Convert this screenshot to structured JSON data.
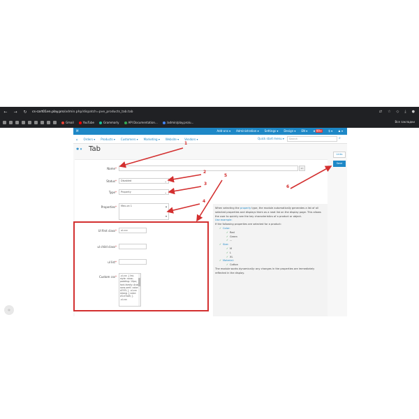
{
  "browser": {
    "url_host": "cs-cart01en.play.pro",
    "url_path": "/admin.php/dispatch=pve_products_tab.tab",
    "bookmarks": [
      {
        "label": "Gmail",
        "color": "#ea4335"
      },
      {
        "label": "YouTube",
        "color": "#ff0000"
      },
      {
        "label": "Grammarly",
        "color": "#15c39a"
      },
      {
        "label": "API Documentation...",
        "color": "#34a853"
      },
      {
        "label": "/admin/play.pro/u...",
        "color": "#4285f4"
      }
    ],
    "bookmarks_right": "Все закладки"
  },
  "app": {
    "topbar": {
      "brand": "M",
      "menu": [
        "Add-ons ▾",
        "Administration ▾",
        "Settings ▾",
        "Design ▾",
        "EN ▾",
        "★",
        "$ ▾",
        "♟ ▾"
      ],
      "badge": "99+"
    },
    "subnav": {
      "items": [
        "⌂",
        "Orders ▾",
        "Products ▾",
        "Customers ▾",
        "Marketing ▾",
        "Website ▾",
        "Vendors ▾"
      ],
      "quick_start": "Quick start menu ▾",
      "search_placeholder": "Search"
    },
    "page_title": "Tab",
    "links_button": "Links",
    "save_button": "Save",
    "form": {
      "name_label": "Name",
      "status_label": "Status",
      "status_value": "Disabled",
      "type_label": "Type",
      "type_value": "Property",
      "properties_label": "Properties",
      "properties_value": "Мех-из 1",
      "lang": "en",
      "ul_first_label": "Ul first class",
      "ul_first_value": "ul.ccc",
      "ul_child_label": "ul child class",
      "ul_child_value": "",
      "ul_list_label": "ul list",
      "ul_list_value": "",
      "custom_css_label": "Custom css",
      "custom_css_value": ".ul.ccc { list-style: none; padding: 10px; font-family: Arial, sans-serif; color: #333; } .ul.ccc strong { color: #1e7bd5; } .ul.ccc"
    },
    "help": {
      "intro_1": "When selecting the ",
      "intro_link": "property",
      "intro_2": " type, the module automatically generates a list of all selected properties and displays them as a neat list on the display page. This allows the user to quickly see the key characteristics of a product or object.",
      "use_example": "Use example:",
      "if_text": "If the following properties are selected for a product:",
      "groups": [
        {
          "name": "Color:",
          "values": [
            "Red",
            "Green",
            "..."
          ]
        },
        {
          "name": "Size:",
          "values": [
            "M",
            "L",
            "XL"
          ]
        },
        {
          "name": "Material:",
          "values": [
            "Cotton"
          ]
        }
      ],
      "footer": "The module works dynamically: any changes in the properties are immediately reflected in the display."
    }
  },
  "annotations": [
    "1",
    "2",
    "3",
    "4",
    "5",
    "6"
  ],
  "colors": {
    "accent": "#1e88c7",
    "annotation": "#d32f2f"
  }
}
